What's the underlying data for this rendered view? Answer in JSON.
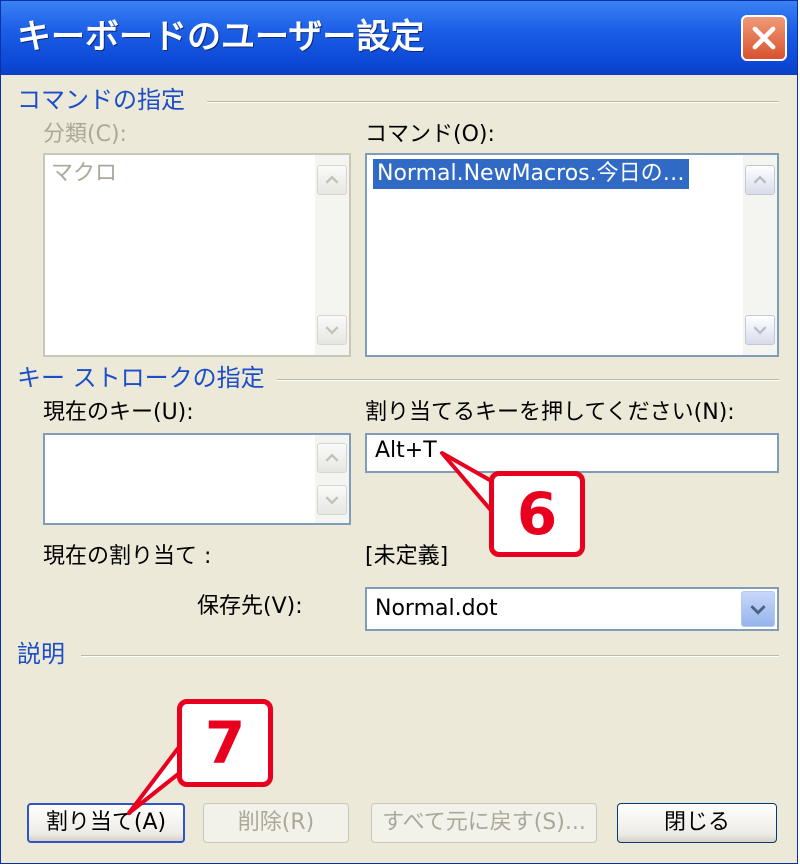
{
  "window": {
    "title": "キーボードのユーザー設定"
  },
  "commands_group": {
    "title": "コマンドの指定",
    "category_label": "分類(C):",
    "categories": [
      "マクロ"
    ],
    "command_label": "コマンド(O):",
    "commands": [
      "Normal.NewMacros.今日の…"
    ]
  },
  "keystroke_group": {
    "title": "キー ストロークの指定",
    "current_keys_label": "現在のキー(U):",
    "new_key_label": "割り当てるキーを押してください(N):",
    "new_key_value": "Alt+T",
    "current_assignment_label": "現在の割り当て :",
    "current_assignment_value": "[未定義]",
    "save_in_label": "保存先(V):",
    "save_in_value": "Normal.dot"
  },
  "description_group": {
    "title": "説明"
  },
  "buttons": {
    "assign": "割り当て(A)",
    "remove": "削除(R)",
    "reset_all": "すべて元に戻す(S)...",
    "close": "閉じる"
  },
  "callouts": {
    "step6": "6",
    "step7": "7",
    "color": "#e8001e"
  },
  "colors": {
    "titlebar": "#0c48d6",
    "group_title": "#1c4ec8",
    "dialog_bg": "#ece9d8",
    "selection": "#316ac5"
  }
}
